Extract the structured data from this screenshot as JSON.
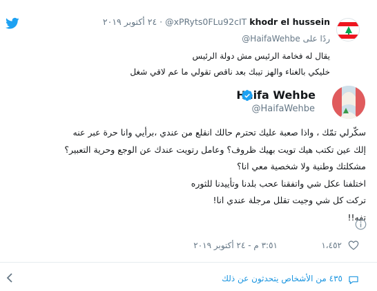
{
  "colors": {
    "brand": "#1da1f2",
    "link": "#1b95e0",
    "muted": "#657786",
    "text": "#14171a",
    "like": "#e0245e"
  },
  "icons": {
    "brand": "twitter-bird-icon",
    "verified": "verified-badge-icon",
    "info": "info-icon",
    "like": "heart-icon",
    "more": "chevron-down-icon",
    "people": "people-icon"
  },
  "reply": {
    "name": "khodr el hussein",
    "handle": "@xPRyts0FLu92cIT",
    "date": "٢٤ أكتوبر ٢٠١٩",
    "separator": "·",
    "replying_prefix": "ردًا على",
    "replying_to": "@HaifaWehbe",
    "lines": [
      "يقال له فخامة الرئيس مش دولة الرئيس",
      "خليكي بالغناء والهز تيبك بعد ناقص تقولي ما عم لاقي شغل"
    ]
  },
  "tweet": {
    "author_name": "Haifa Wehbe",
    "author_handle": "@HaifaWehbe",
    "lines": [
      "سكّرلي تمّك ، واذا صعبة عليك تحترم حالك انقلع من عندي ،برأيي وانا حرة عبر عنه",
      "إلك عين تكتب هيك تويت بهيك ظروف؟ وعامل رتويت عندك عن الوجع وحرية التعبير؟",
      "مشكلتك وطنية ولا شخصية معي انا؟",
      "اختلفنا عكل شي واتفقنا عحب بلدنا وتأييدنا للثوره",
      "تركت كل شي وجيت تقلل مرجلة عندي انا!",
      "تفه!!"
    ],
    "likes": "١،٤٥٢",
    "timestamp": "٣:٥١ م - ٢٤ أكتوبر ٢٠١٩"
  },
  "footer": {
    "people_talking": "٤٣٥ من الأشخاص يتحدثون عن ذلك"
  }
}
